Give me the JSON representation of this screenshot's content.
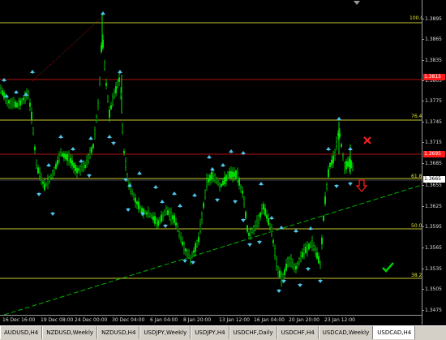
{
  "chart": {
    "symbol_current_price": "1.3665",
    "price_ticks": [
      "1.3895",
      "1.3865",
      "1.3835",
      "1.3805",
      "1.3775",
      "1.3745",
      "1.3715",
      "1.3685",
      "1.3655",
      "1.3625",
      "1.3595",
      "1.3565",
      "1.3535",
      "1.3505",
      "1.3475"
    ],
    "price_tags": [
      {
        "label": "1.3815",
        "color": "#ff1a1a"
      },
      {
        "label": "1.3695",
        "color": "#ff1a1a"
      },
      {
        "label": "1.3665",
        "color": "#ffffff",
        "text_color": "#000000"
      }
    ],
    "fib_levels": [
      {
        "label": "100.0"
      },
      {
        "label": "76.4"
      },
      {
        "label": "61.8"
      },
      {
        "label": "50.0"
      },
      {
        "label": "38.2"
      }
    ],
    "time_ticks": [
      "16 Dec 16:00",
      "19 Dec 08:00",
      "24 Dec 00:00",
      "30 Dec 04:00",
      "6 Jan 04:00",
      "8 Jan 20:00",
      "13 Jan 12:00",
      "16 Jan 04:00",
      "20 Jan 20:00",
      "23 Jan 12:00"
    ],
    "colors": {
      "candle": "#00e600",
      "fib_line": "#c8c832",
      "grid_level_red": "#b01010",
      "trend_line": "#00b400",
      "fractal_arrow": "#4fc3e8",
      "sell_arrow": "#ff2020",
      "check_mark": "#00cc00",
      "cross_mark": "#ff2020"
    },
    "icons": [
      "sell-arrow-icon",
      "cross-icon",
      "check-icon",
      "fractal-arrow-icon"
    ]
  },
  "tabs": [
    {
      "label": "AUDUSD,H4",
      "active": false
    },
    {
      "label": "NZDUSD,Weekly",
      "active": false
    },
    {
      "label": "NZDUSD,H4",
      "active": false
    },
    {
      "label": "USDJPY,Weekly",
      "active": false
    },
    {
      "label": "USDJPY,H4",
      "active": false
    },
    {
      "label": "USDCHF,Daily",
      "active": false
    },
    {
      "label": "USDCHF,H4",
      "active": false
    },
    {
      "label": "USDCAD,Weekly",
      "active": false
    },
    {
      "label": "USDCAD,H4",
      "active": true
    }
  ]
}
